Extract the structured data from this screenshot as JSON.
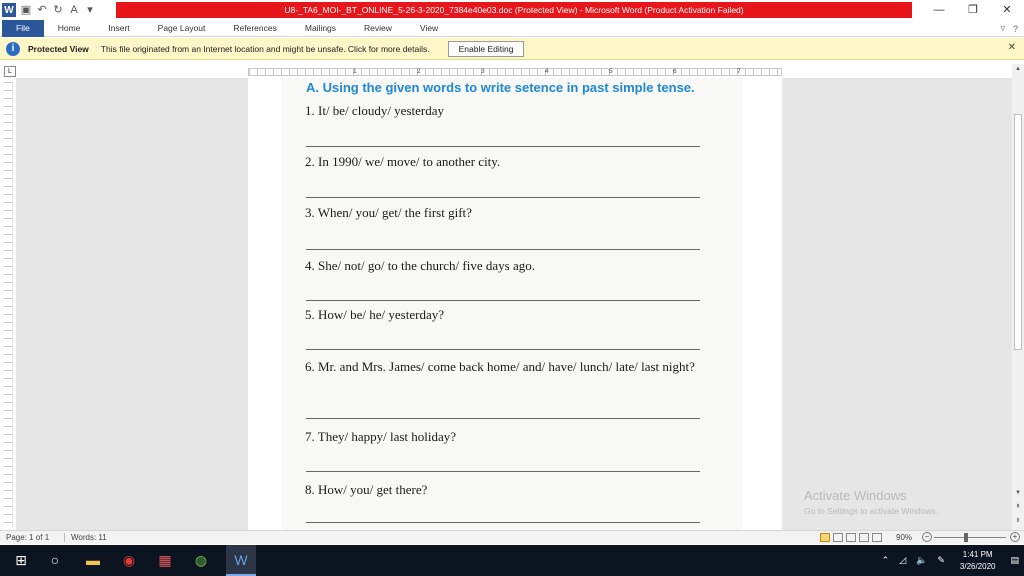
{
  "titlebar": {
    "title": "U8-_TA6_MOI-_BT_ONLINE_5-26-3-2020_7384e40e03.doc (Protected View) - Microsoft Word (Product Activation Failed)",
    "app_icon": "W",
    "qat_icons": [
      "save-icon",
      "undo-icon",
      "redo-icon",
      "font-color-icon",
      "customize-icon"
    ],
    "controls": {
      "minimize": "—",
      "restore": "❐",
      "close": "✕"
    }
  },
  "ribbon": {
    "tabs": [
      "File",
      "Home",
      "Insert",
      "Page Layout",
      "References",
      "Mailings",
      "Review",
      "View"
    ],
    "right_icons": [
      "chevron-down-icon",
      "help-icon"
    ]
  },
  "protected_view": {
    "title": "Protected View",
    "message": "This file originated from an Internet location and might be unsafe. Click for more details.",
    "button": "Enable Editing",
    "close": "✕"
  },
  "ruler": {
    "corner_label": "L",
    "numbers": [
      "1",
      "2",
      "3",
      "4",
      "5",
      "6",
      "7"
    ]
  },
  "document": {
    "heading": "A. Using the given words to write setence in past simple tense.",
    "questions": [
      {
        "text": "1. It/ be/ cloudy/ yesterday"
      },
      {
        "text": "2. In 1990/ we/ move/ to another city."
      },
      {
        "text": "3. When/ you/ get/ the first gift?"
      },
      {
        "text": "4. She/ not/ go/ to the church/ five days ago."
      },
      {
        "text": "5. How/ be/ he/ yesterday?"
      },
      {
        "text": "6. Mr. and Mrs. James/ come back home/ and/ have/ lunch/ late/ last night?"
      },
      {
        "text": "7. They/ happy/ last holiday?"
      },
      {
        "text": "8. How/ you/ get there?"
      }
    ]
  },
  "watermark": {
    "line1": "Activate Windows",
    "line2": "Go to Settings to activate Windows."
  },
  "statusbar": {
    "page": "Page: 1 of 1",
    "words": "Words: 11",
    "zoom": "90%"
  },
  "taskbar": {
    "time": "1:41 PM",
    "date": "3/26/2020"
  },
  "colors": {
    "title_red": "#e8151b",
    "word_blue": "#2b579a",
    "heading_blue": "#1e88d6",
    "protected_bar": "#fdf6c6",
    "taskbar": "#0d1421"
  }
}
